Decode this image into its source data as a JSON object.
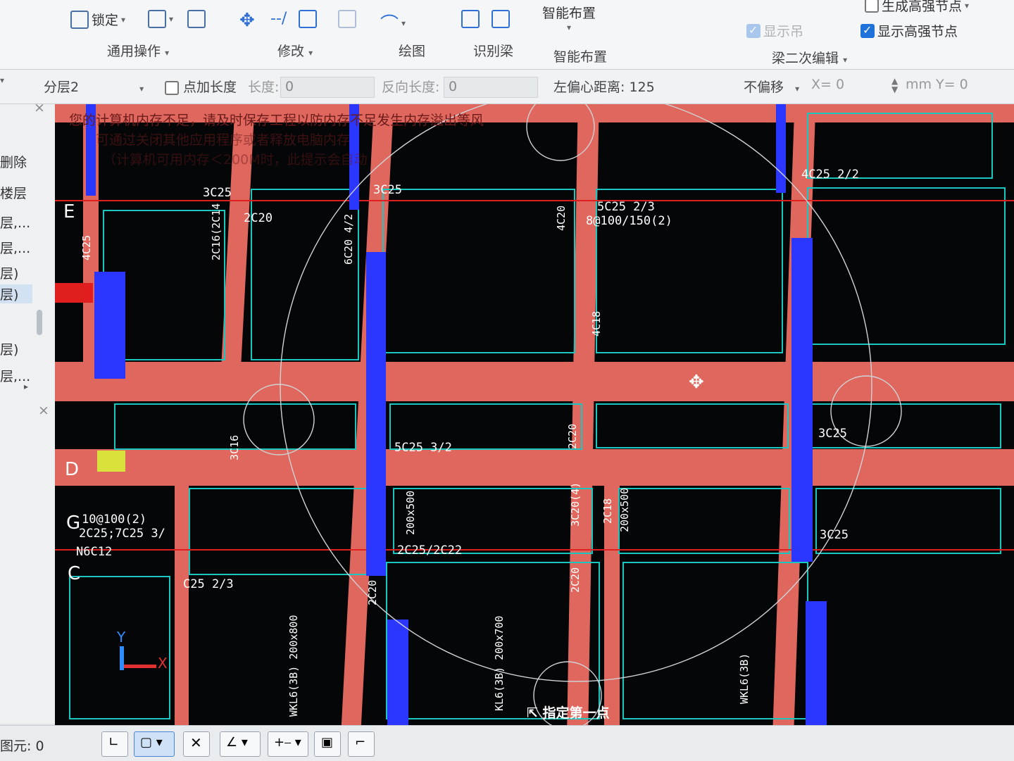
{
  "ribbon": {
    "lock_label": "锁定",
    "smart_layout_top": "智能布置",
    "generate_bolt_node": "生成高强节点",
    "show_bolt_node": "显示高强节点",
    "show_hint": "显示吊",
    "groups": {
      "general": "通用操作",
      "modify": "修改",
      "draw": "绘图",
      "recognize_beam": "识别梁",
      "smart_layout": "智能布置",
      "beam_edit": "梁二次编辑"
    }
  },
  "propbar": {
    "layer": "分层2",
    "add_length_label": "点加长度",
    "length_label": "长度:",
    "length_value": "0",
    "reverse_length_label": "反向长度:",
    "reverse_length_value": "0",
    "left_offset": "左偏心距离: 125",
    "offset_mode": "不偏移",
    "x_label": "X= 0",
    "y_label": "mm Y= 0"
  },
  "leftpanel": {
    "items": [
      "删除",
      "楼层",
      "层,...",
      "层,...",
      "层)",
      "层)",
      "层)",
      "层,..."
    ]
  },
  "canvas": {
    "warning_line1": "您的计算机内存不足，请及时保存工程以防内存不足发生内存溢出等风",
    "warning_line2": "可通过关闭其他应用程序或者释放电脑内存",
    "warning_line3": "（计算机可用内存＜200M时，此提示会自动",
    "prompt": "指定第一点",
    "axis_labels": {
      "e": "E",
      "d": "D",
      "g": "G",
      "c": "C"
    },
    "beam_labels": {
      "a1": "3C25",
      "a2": "3C25",
      "a3": "2C20",
      "a4": "5C25 2/3",
      "a5": "8@100/150(2)",
      "a6": "4C25 2/2",
      "a7": "5C25 3/2",
      "a8": "3C25",
      "a9": "2C25/2C22",
      "a10": "3C25",
      "a11": "C25 2/3",
      "a12": "10@100(2)",
      "a13": "2C25;7C25 3/",
      "a14": "N6C12"
    },
    "vertical_labels": {
      "v1": "4C25",
      "v2": "2C16(2C14",
      "v3": "6C20 4/2",
      "v4": "4C20",
      "v5": "4C18",
      "v6": "3C16",
      "v7": "2C20",
      "v8": "2C20",
      "v9": "2C20",
      "v10": "200x500",
      "v11": "3C20(4)",
      "v12": "2C18",
      "v13": "200x500",
      "v14": "KL6(3B) 200x700",
      "v15": "WKL6(3B) 200x800",
      "v16": "WKL6(3B)"
    }
  },
  "statusbar": {
    "element_count": "图元: 0"
  }
}
